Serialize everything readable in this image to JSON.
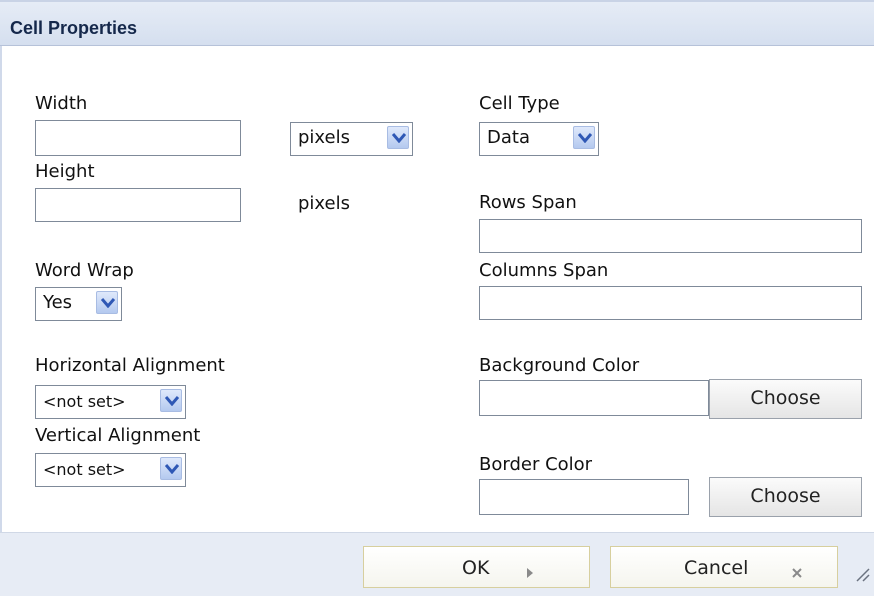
{
  "dialog": {
    "title": "Cell Properties"
  },
  "width": {
    "label": "Width",
    "value": "",
    "unit_value": "pixels"
  },
  "height": {
    "label": "Height",
    "value": "",
    "unit": "pixels"
  },
  "word_wrap": {
    "label": "Word Wrap",
    "value": "Yes"
  },
  "horizontal_alignment": {
    "label": "Horizontal Alignment",
    "value": "<not set>"
  },
  "vertical_alignment": {
    "label": "Vertical Alignment",
    "value": "<not set>"
  },
  "cell_type": {
    "label": "Cell Type",
    "value": "Data"
  },
  "rows_span": {
    "label": "Rows Span",
    "value": ""
  },
  "columns_span": {
    "label": "Columns Span",
    "value": ""
  },
  "background_color": {
    "label": "Background Color",
    "value": "",
    "button": "Choose"
  },
  "border_color": {
    "label": "Border Color",
    "value": "",
    "button": "Choose"
  },
  "footer": {
    "ok": "OK",
    "ok_icon": "arrow-right-icon",
    "cancel": "Cancel",
    "cancel_icon": "close-icon"
  },
  "colors": {
    "title_text": "#15284b",
    "dropdown_arrow": "#2f58b5",
    "footer_bg": "#e7ecf5"
  }
}
